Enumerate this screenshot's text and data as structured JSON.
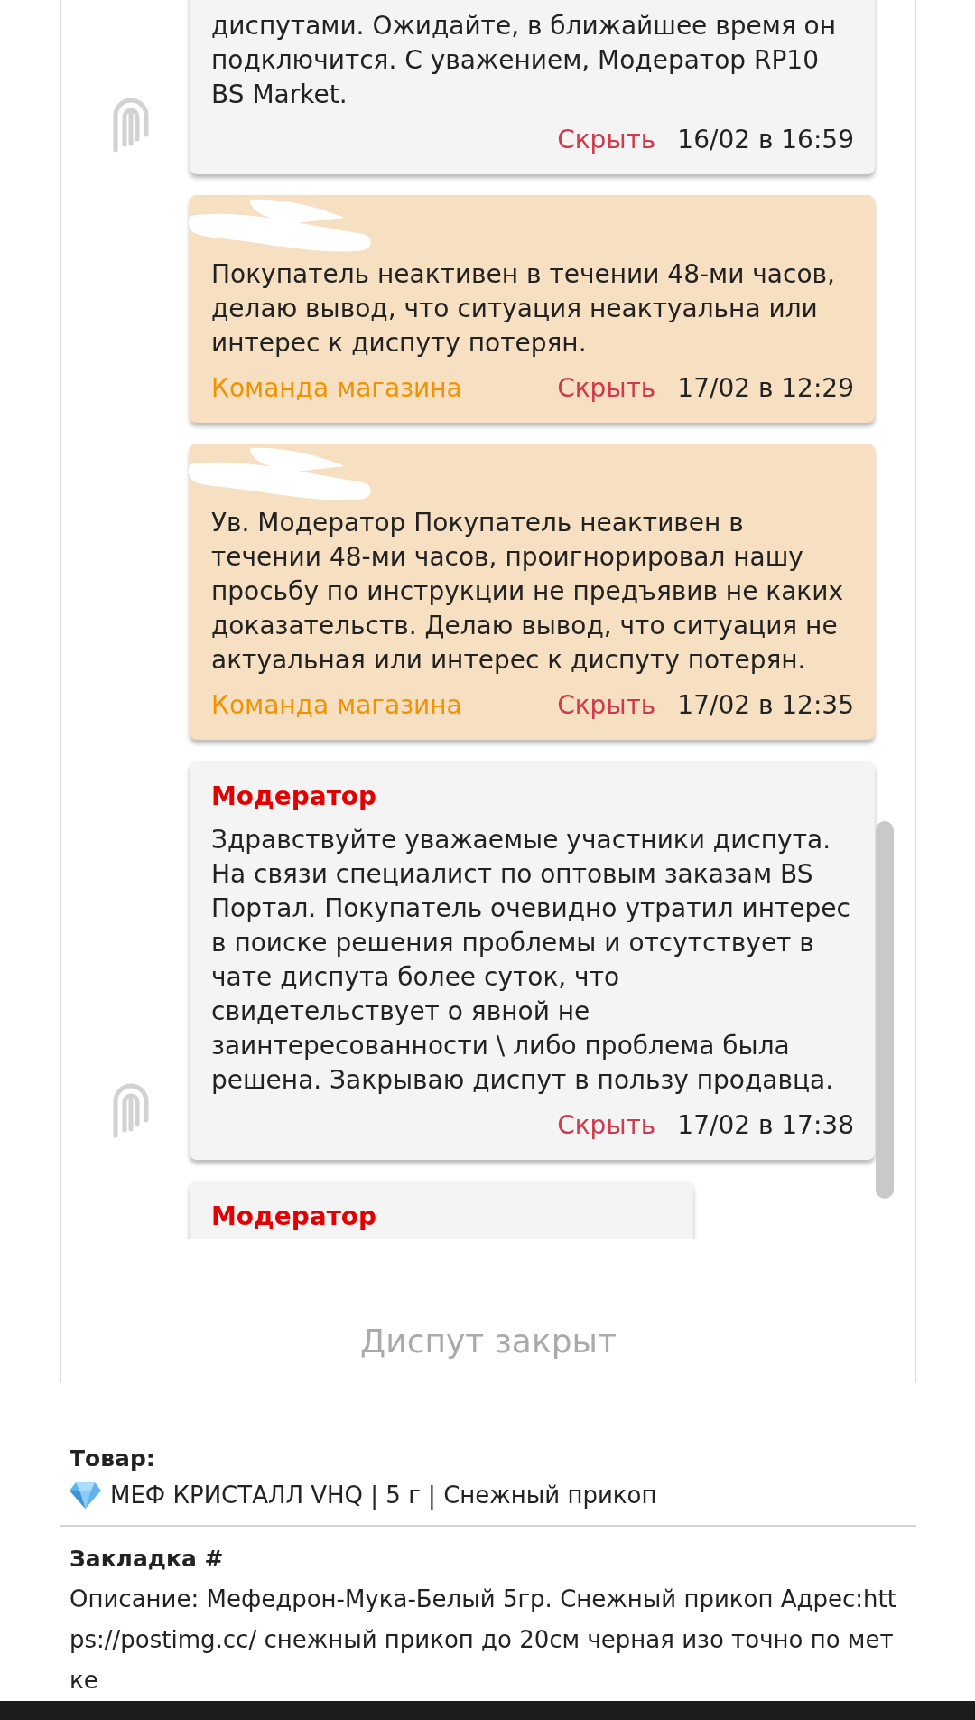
{
  "chat": {
    "messages": [
      {
        "kind": "moderator",
        "avatar": true,
        "text": "диспутами. Ожидайте, в ближайшее время он подключится. С уважением, Модератор RP10 BS Market.",
        "hide_link": "Скрыть",
        "time": "16/02 в 16:59"
      },
      {
        "kind": "shop",
        "sender_redacted": true,
        "text": "Покупатель неактивен в течении 48-ми часов, делаю вывод, что ситуация неактуальна или интерес к диспуту потерян.",
        "team_label": "Команда магазина",
        "hide_link": "Скрыть",
        "time": "17/02 в 12:29"
      },
      {
        "kind": "shop",
        "sender_redacted": true,
        "text": "Ув. Модератор Покупатель неактивен в течении 48-ми часов, проигнорировал нашу просьбу по инструкции не предъявив не каких доказательств. Делаю вывод, что ситуация не актуальная или интерес к диспуту потерян.",
        "team_label": "Команда магазина",
        "hide_link": "Скрыть",
        "time": "17/02 в 12:35"
      },
      {
        "kind": "moderator",
        "avatar": true,
        "author": "Модератор",
        "text": "Здравствуйте уважаемые участники диспута. На связи специалист по оптовым заказам BS Портал. Покупатель очевидно утратил интерес в поиске решения проблемы и отсутствует в чате диспута более суток, что свидетельствует о явной не заинтересованности \\ либо проблема была решена. Закрываю диспут в пользу продавца.",
        "hide_link": "Скрыть",
        "time": "17/02 в 17:38"
      },
      {
        "kind": "moderator",
        "author": "Модератор"
      }
    ],
    "status": "Диспут закрыт"
  },
  "product": {
    "label": "Товар:",
    "name": "МЕФ КРИСТАЛЛ VHQ | 5 г | Снежный прикоп"
  },
  "drop": {
    "label": "Закладка #",
    "description": "Описание: Мефедрон-Мука-Белый 5гр. Снежный прикоп Адрес:https://postimg.cc/ снежный прикоп до 20см черная изо точно по метке"
  }
}
